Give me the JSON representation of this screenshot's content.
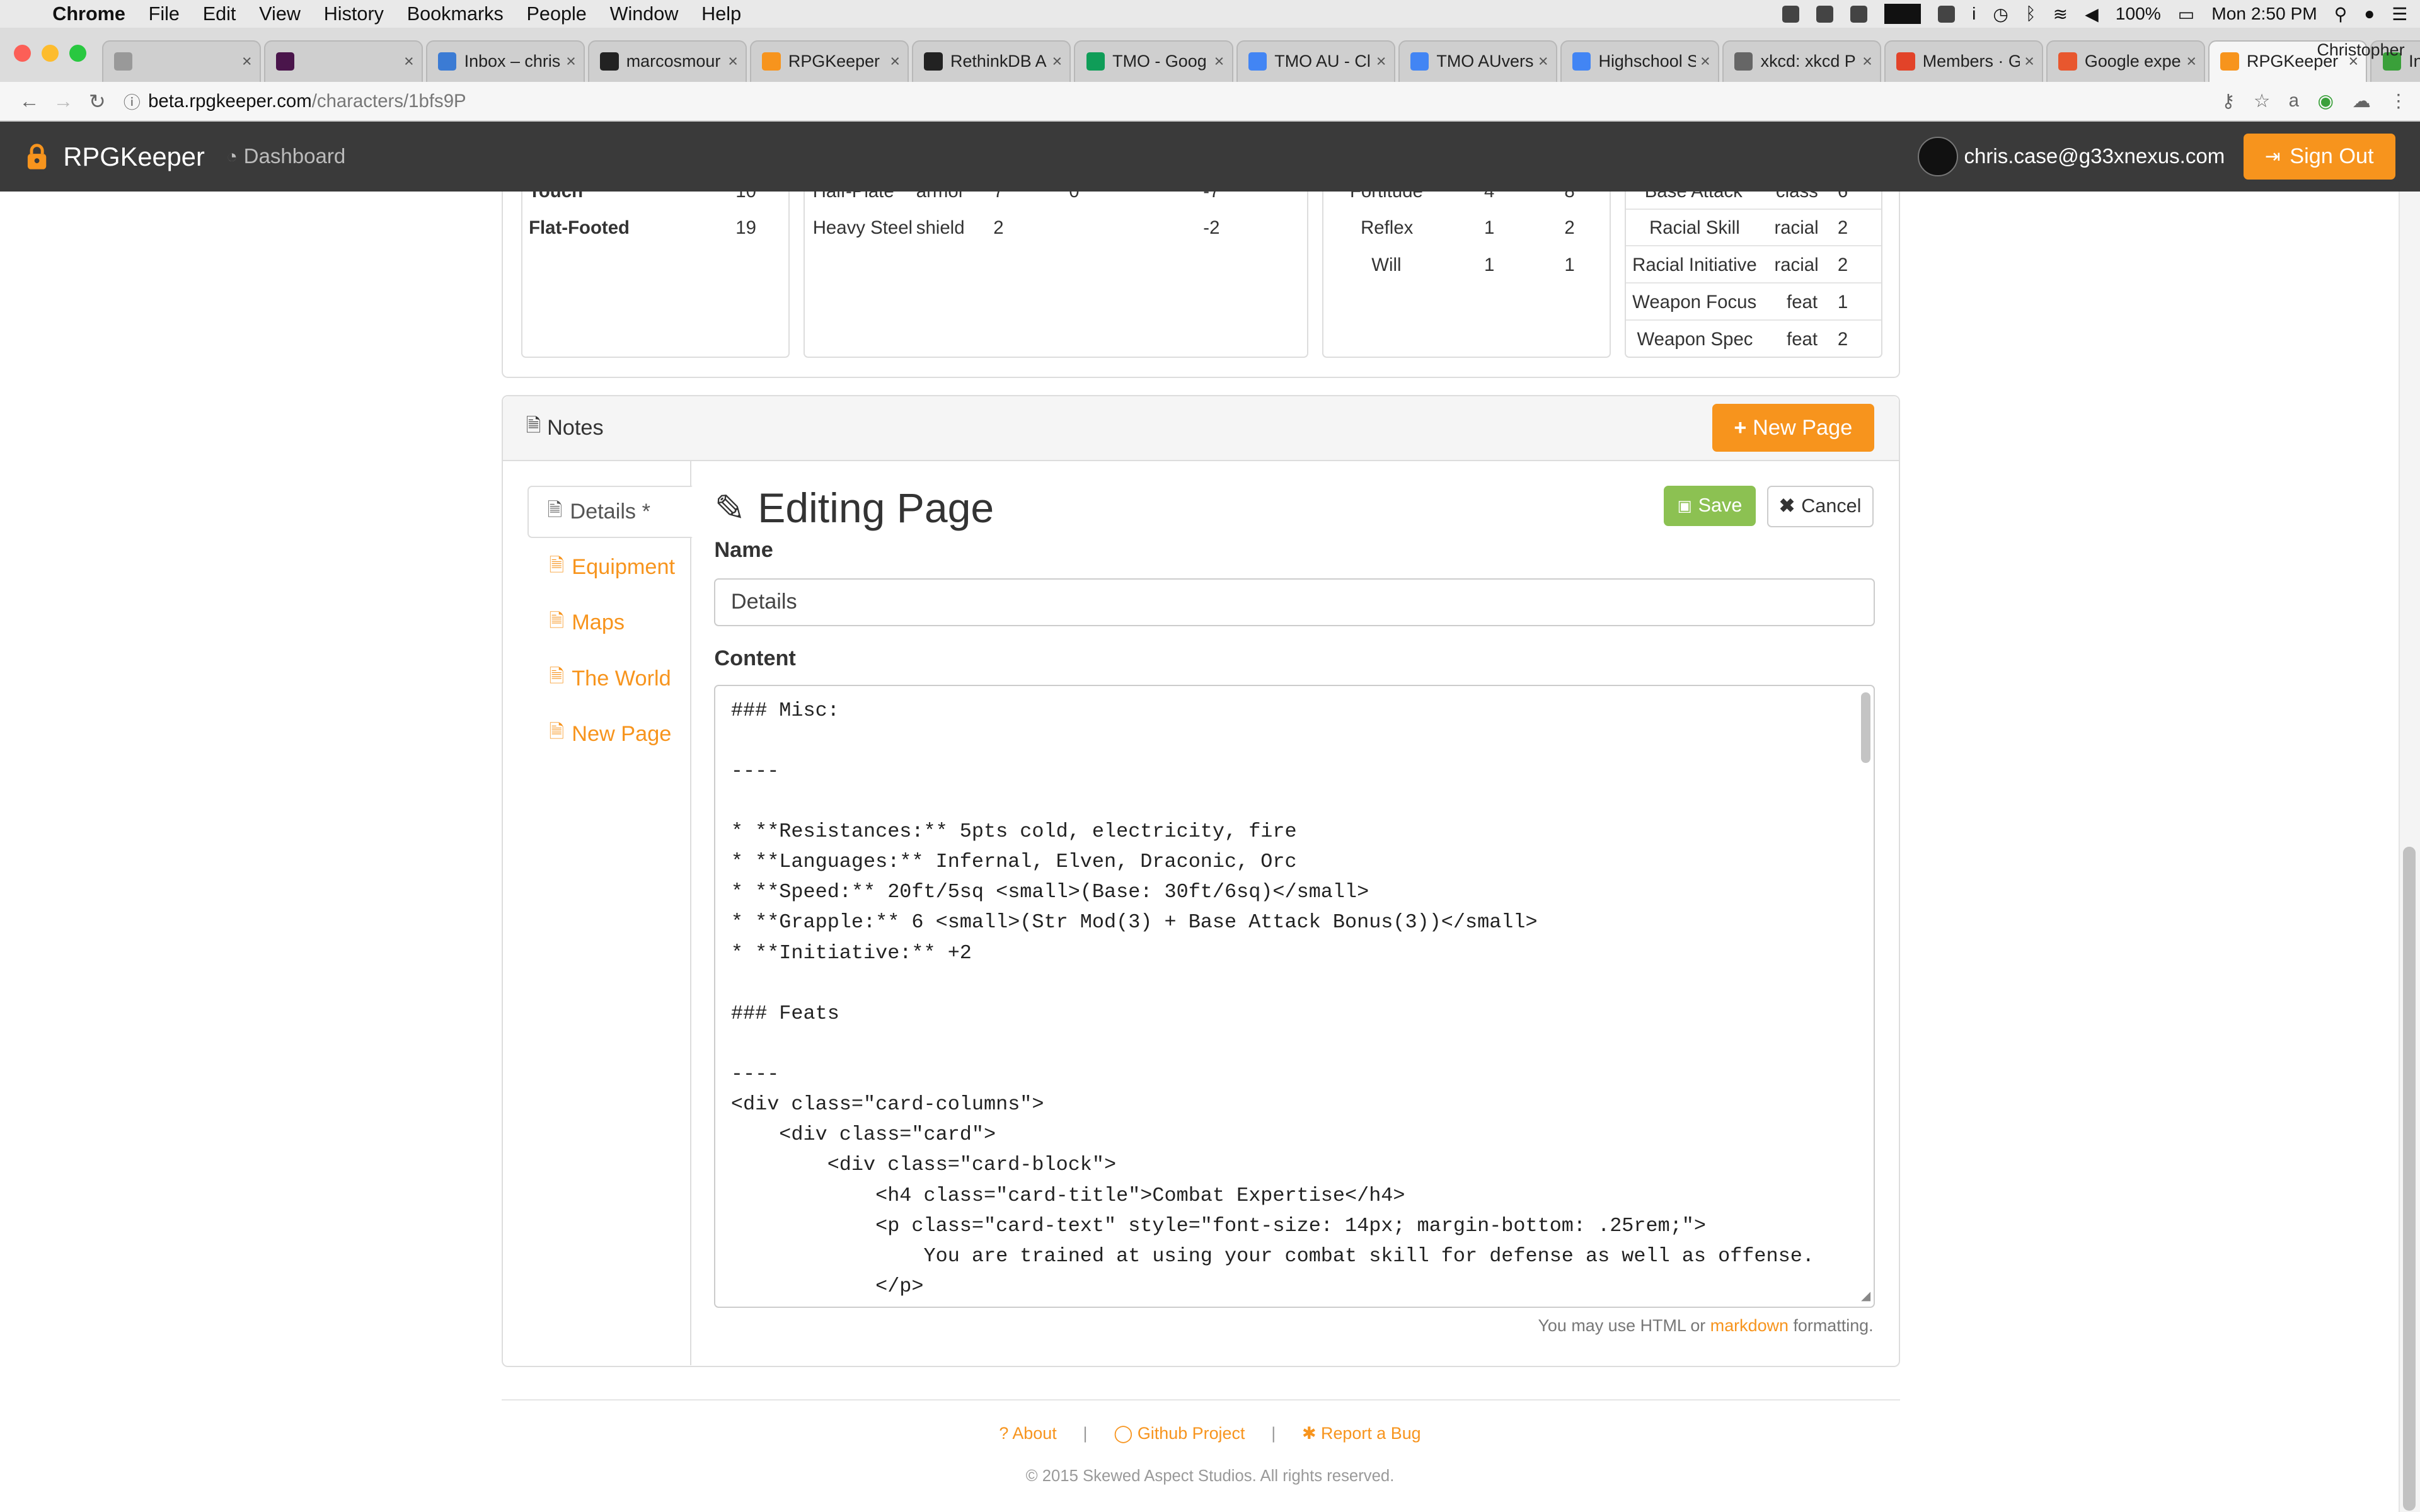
{
  "menubar": {
    "app": "Chrome",
    "items": [
      "File",
      "Edit",
      "View",
      "History",
      "Bookmarks",
      "People",
      "Window",
      "Help"
    ],
    "battery": "100%",
    "clock": "Mon 2:50 PM"
  },
  "tabs": [
    {
      "title": "",
      "fav": "#999"
    },
    {
      "title": "",
      "fav": "#4a154b"
    },
    {
      "title": "Inbox – chris",
      "fav": "#3b7bd4"
    },
    {
      "title": "marcosmour",
      "fav": "#222"
    },
    {
      "title": "RPGKeeper",
      "fav": "#f7941d"
    },
    {
      "title": "RethinkDB A",
      "fav": "#222"
    },
    {
      "title": "TMO - Goog",
      "fav": "#0f9d58"
    },
    {
      "title": "TMO AU - Cl",
      "fav": "#4285f4"
    },
    {
      "title": "TMO AUvers",
      "fav": "#4285f4"
    },
    {
      "title": "Highschool S",
      "fav": "#4285f4"
    },
    {
      "title": "xkcd: xkcd P",
      "fav": "#666"
    },
    {
      "title": "Members · G",
      "fav": "#e24329"
    },
    {
      "title": "Google expe",
      "fav": "#e8572e"
    },
    {
      "title": "RPGKeeper",
      "fav": "#f7941d",
      "active": true
    },
    {
      "title": "Internet Stat",
      "fav": "#3aa03a"
    }
  ],
  "profile_name": "Christopher",
  "address": {
    "host": "beta.rpgkeeper.com",
    "path": "/characters/1bfs9P"
  },
  "navbar": {
    "brand": "RPGKeeper",
    "dashboard": "Dashboard",
    "user_email": "chris.case@g33xnexus.com",
    "sign_out": "Sign Out"
  },
  "stats": {
    "ac": [
      {
        "label": "Touch",
        "value": "10"
      },
      {
        "label": "Flat-Footed",
        "value": "19"
      }
    ],
    "armor": [
      {
        "name": "Half-Plate",
        "type": "armor",
        "bonus": "7",
        "dex": "0",
        "penalty": "-7"
      },
      {
        "name": "Heavy Steel",
        "type": "shield",
        "bonus": "2",
        "dex": "",
        "penalty": "-2"
      }
    ],
    "saves": [
      {
        "name": "Fortitude",
        "base": "4",
        "total": "8"
      },
      {
        "name": "Reflex",
        "base": "1",
        "total": "2"
      },
      {
        "name": "Will",
        "base": "1",
        "total": "1"
      }
    ],
    "bonuses": [
      {
        "name": "Base Attack",
        "source": "class",
        "value": "6"
      },
      {
        "name": "Racial Skill",
        "source": "racial",
        "value": "2"
      },
      {
        "name": "Racial Initiative",
        "source": "racial",
        "value": "2"
      },
      {
        "name": "Weapon Focus",
        "source": "feat",
        "value": "1"
      },
      {
        "name": "Weapon Spec",
        "source": "feat",
        "value": "2"
      }
    ]
  },
  "notes": {
    "title": "Notes",
    "new_page_button": "New Page",
    "pages": [
      {
        "label": "Details *",
        "active": true
      },
      {
        "label": "Equipment"
      },
      {
        "label": "Maps"
      },
      {
        "label": "The World"
      },
      {
        "label": "New Page"
      }
    ]
  },
  "editor": {
    "heading": "Editing Page",
    "save": "Save",
    "cancel": "Cancel",
    "name_label": "Name",
    "name_value": "Details",
    "content_label": "Content",
    "content": "### Misc:\n\n----\n\n* **Resistances:** 5pts cold, electricity, fire\n* **Languages:** Infernal, Elven, Draconic, Orc\n* **Speed:** 20ft/5sq <small>(Base: 30ft/6sq)</small>\n* **Grapple:** 6 <small>(Str Mod(3) + Base Attack Bonus(3))</small>\n* **Initiative:** +2\n\n### Feats\n\n----\n<div class=\"card-columns\">\n    <div class=\"card\">\n        <div class=\"card-block\">\n            <h4 class=\"card-title\">Combat Expertise</h4>\n            <p class=\"card-text\" style=\"font-size: 14px; margin-bottom: .25rem;\">\n                You are trained at using your combat skill for defense as well as offense.\n            </p>",
    "hint_prefix": "You may use HTML or",
    "hint_link": "markdown",
    "hint_suffix": "formatting."
  },
  "footer": {
    "about": "About",
    "github": "Github Project",
    "bug": "Report a Bug",
    "copyright": "© 2015 Skewed Aspect Studios. All rights reserved."
  }
}
